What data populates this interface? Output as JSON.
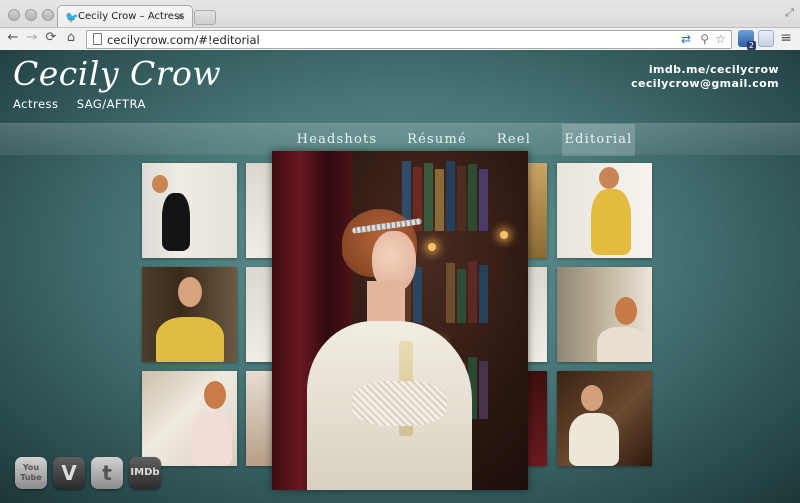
{
  "browser": {
    "tab_title": "Cecily Crow – Actress",
    "tab_close": "×",
    "favicon": "🐦",
    "url": "cecilycrow.com/#!editorial",
    "nav": {
      "back": "←",
      "forward": "→",
      "reload": "⟳",
      "home": "⌂"
    },
    "extensions": {
      "badge_count": "2"
    },
    "icons": {
      "translate": "⇄",
      "search": "⚲",
      "star": "☆",
      "menu": "≡",
      "resize": "⤢"
    }
  },
  "site": {
    "brand": "Cecily Crow",
    "tagline": [
      "Actress",
      "SAG/AFTRA"
    ],
    "contact": {
      "imdb": "imdb.me/cecilycrow",
      "email": "cecilycrow@gmail.com"
    },
    "nav": [
      {
        "label": "Headshots",
        "active": false
      },
      {
        "label": "Résumé",
        "active": false
      },
      {
        "label": "Reel",
        "active": false
      },
      {
        "label": "Editorial",
        "active": true
      }
    ],
    "gallery_count": 12,
    "social": [
      {
        "name": "youtube",
        "label": "You Tube"
      },
      {
        "name": "vimeo",
        "label": "V"
      },
      {
        "name": "twitter",
        "label": "t"
      },
      {
        "name": "imdb",
        "label": "IMDb"
      }
    ]
  },
  "colors": {
    "page_bg": "#477576",
    "accent_text": "#ffffff",
    "nav_active": "rgba(255,255,255,0.18)"
  }
}
